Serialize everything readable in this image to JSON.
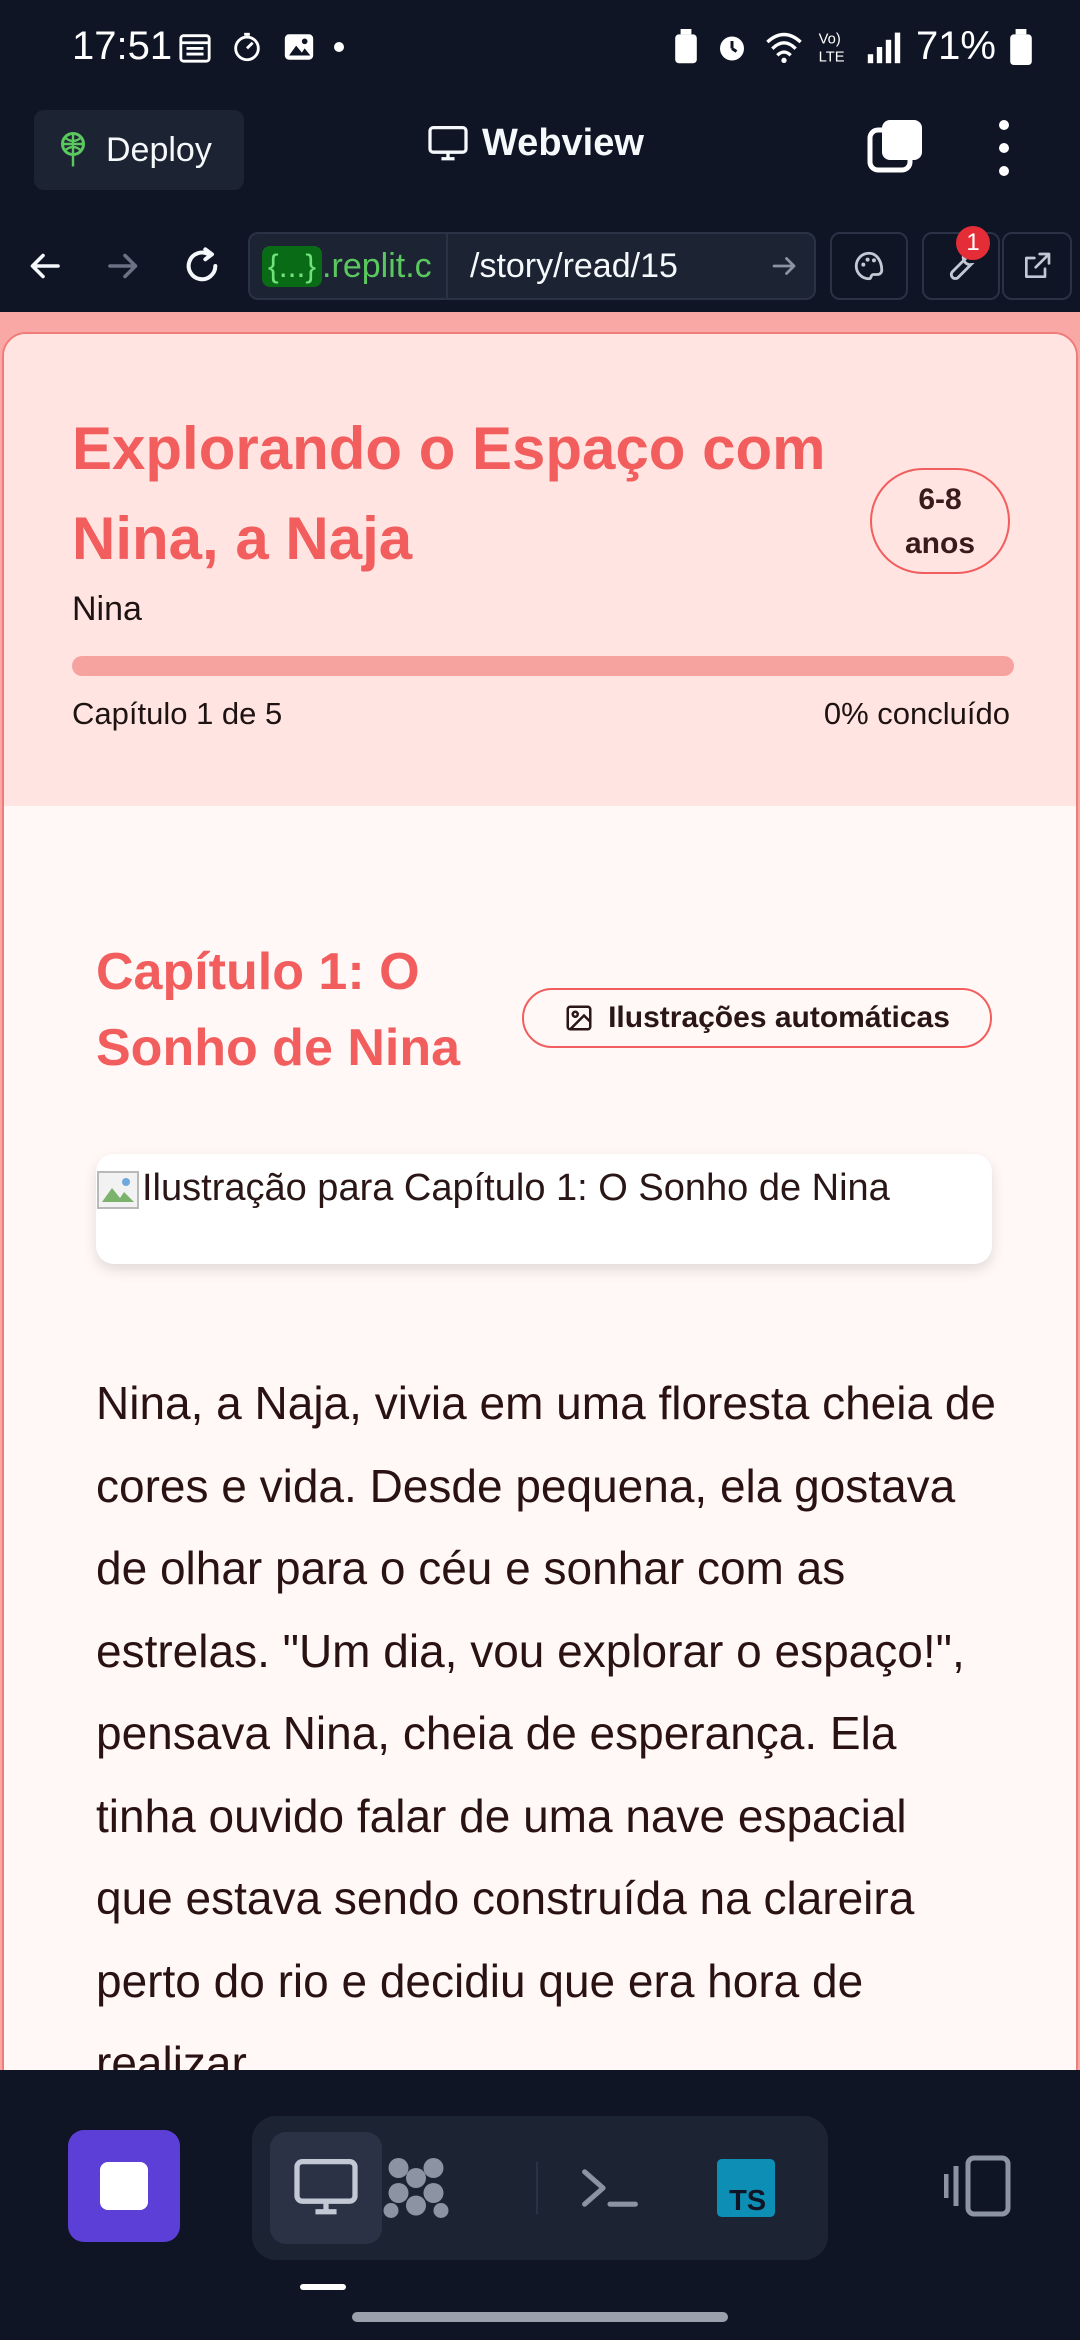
{
  "status_bar": {
    "time": "17:51",
    "battery": "71%"
  },
  "app_header": {
    "deploy_label": "Deploy",
    "webview_label": "Webview"
  },
  "browser": {
    "url_badge": "{...}",
    "url_host": ".replit.c",
    "url_path": "/story/read/15",
    "notification_count": "1"
  },
  "story": {
    "title": "Explorando o Espaço com Nina, a Naja",
    "age_line1": "6-8",
    "age_line2": "anos",
    "author": "Nina",
    "chapter_progress": "Capítulo 1 de 5",
    "percent_label": "0% concluído",
    "progress_fraction": 0.0
  },
  "chapter": {
    "title": "Capítulo 1: O Sonho de Nina",
    "illustrations_button": "Ilustrações automáticas",
    "image_alt": "Ilustração para Capítulo 1: O Sonho de Nina",
    "text": "Nina, a Naja, vivia em uma floresta cheia de cores e vida. Desde pequena, ela gostava de olhar para o céu e sonhar com as estrelas. \"Um dia, vou explorar o espaço!\", pensava Nina, cheia de esperança. Ela tinha ouvido falar de uma nave espacial que estava sendo construída na clareira perto do rio e decidiu que era hora de realizar"
  },
  "colors": {
    "accent": "#f25d5d",
    "header_bg": "#ffe4e1",
    "replit_bg": "#0f1524",
    "run_button": "#5c3fd6"
  }
}
